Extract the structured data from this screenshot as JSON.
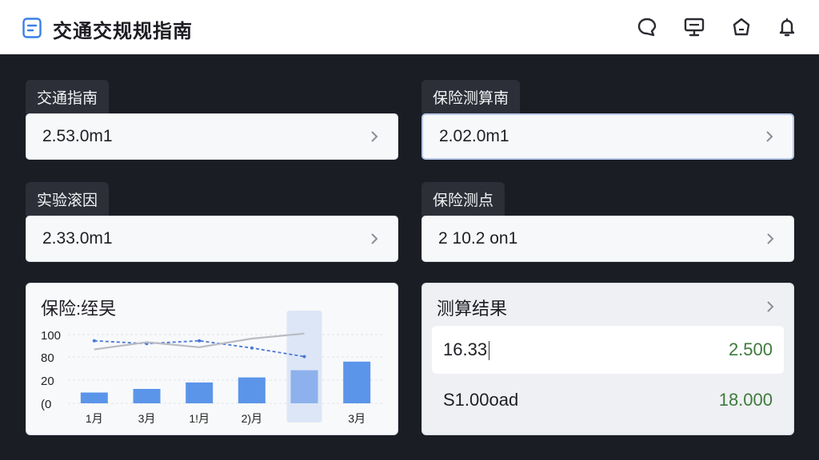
{
  "header": {
    "title": "交通交规规指南",
    "icons": [
      "chat-icon",
      "monitor-icon",
      "home-icon",
      "bell-icon"
    ]
  },
  "fields": [
    {
      "label": "交通指南",
      "value": "2.53.0m1"
    },
    {
      "label": "保险测算南",
      "value": "2.02.0m1"
    },
    {
      "label": "实验滚因",
      "value": "2.33.0m1"
    },
    {
      "label": "保险测点",
      "value": "2 10.2 on1"
    }
  ],
  "chart_panel": {
    "title": "保险:绖旲"
  },
  "chart_data": {
    "type": "bar",
    "categories": [
      "1月",
      "3月",
      "1!月",
      "2)月",
      "",
      "3月"
    ],
    "values": [
      15,
      20,
      29,
      36,
      46,
      58
    ],
    "y_ticks": [
      "100",
      "80",
      "20",
      "(0"
    ],
    "lines": [
      {
        "style": "dashed-blue",
        "values": [
          87,
          83,
          87,
          77,
          65
        ]
      },
      {
        "style": "gray",
        "values": [
          75,
          85,
          78,
          90,
          97
        ]
      }
    ],
    "highlight_index": 4,
    "colors": {
      "bar": "#5b95ea",
      "dashed": "#4a78d6",
      "gray": "#b9bcc2"
    }
  },
  "results_panel": {
    "title": "测算结果",
    "rows": [
      {
        "label": "16.33",
        "value": "2.500"
      },
      {
        "label": "S1.00oad",
        "value": "18.000"
      }
    ]
  }
}
